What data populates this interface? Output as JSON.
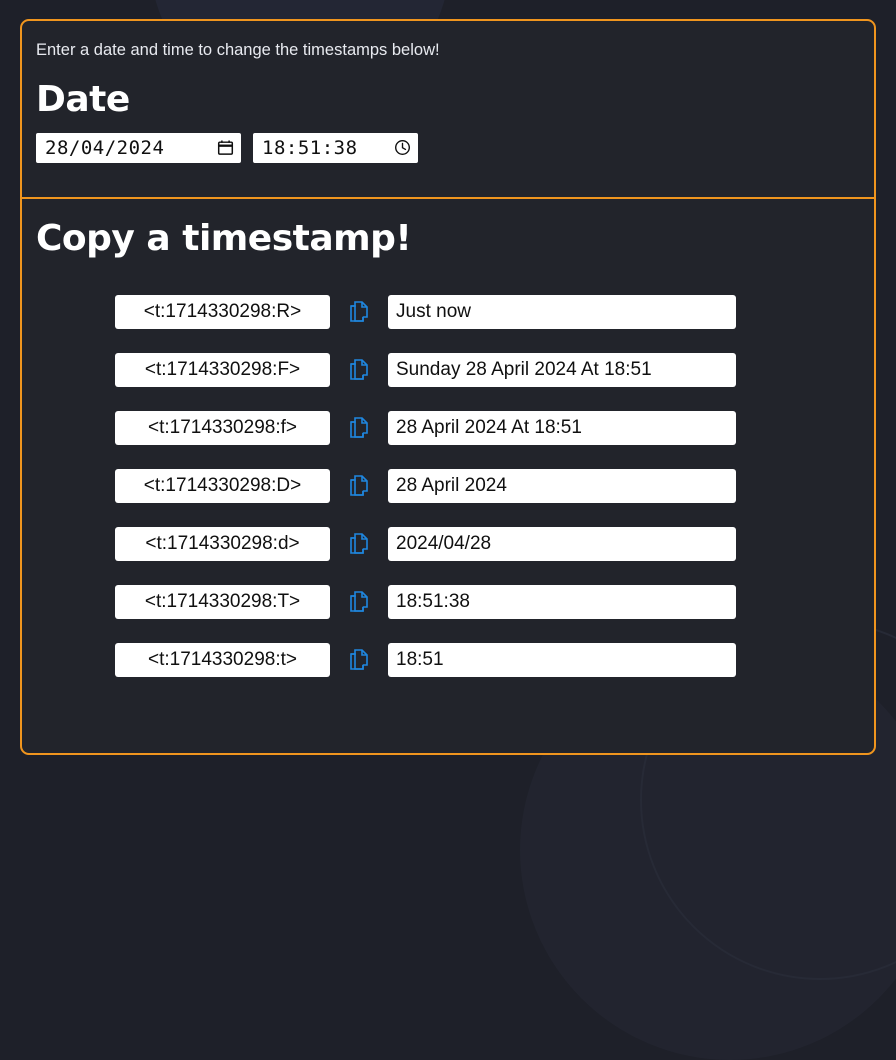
{
  "theme": {
    "page_background": "#1e2029",
    "card_background": "#22242b",
    "accent_border": "#f0951e",
    "copy_icon_color": "#1f87e0",
    "field_background": "#ffffff",
    "field_text": "#101010",
    "heading_text": "#ffffff"
  },
  "date_section": {
    "intro": "Enter a date and time to change the timestamps below!",
    "heading": "Date",
    "date_input": {
      "value": "28/04/2024",
      "placeholder": "dd/mm/yyyy",
      "icon": "calendar-icon"
    },
    "time_input": {
      "value": "18:51:38",
      "placeholder": "hh:mm:ss",
      "icon": "clock-icon"
    }
  },
  "copy_section": {
    "heading": "Copy a timestamp!",
    "copy_icon": "copy-icon",
    "rows": [
      {
        "format": "R",
        "code": "<t:1714330298:R>",
        "output": "Just now"
      },
      {
        "format": "F",
        "code": "<t:1714330298:F>",
        "output": "Sunday 28 April 2024 At 18:51"
      },
      {
        "format": "f",
        "code": "<t:1714330298:f>",
        "output": "28 April 2024 At 18:51"
      },
      {
        "format": "D",
        "code": "<t:1714330298:D>",
        "output": "28 April 2024"
      },
      {
        "format": "d",
        "code": "<t:1714330298:d>",
        "output": "2024/04/28"
      },
      {
        "format": "T",
        "code": "<t:1714330298:T>",
        "output": "18:51:38"
      },
      {
        "format": "t",
        "code": "<t:1714330298:t>",
        "output": "18:51"
      }
    ]
  }
}
